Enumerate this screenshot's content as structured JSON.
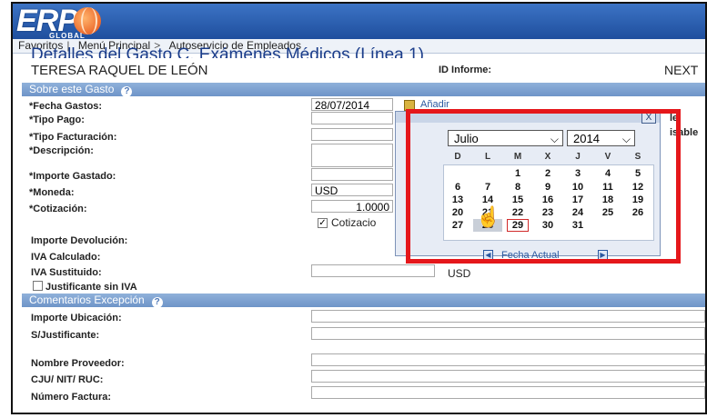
{
  "app": {
    "logo_text": "ERP",
    "logo_subtext": "GLOBAL"
  },
  "nav": {
    "items": [
      "Favoritos",
      "Menú Principal",
      "Autoservicio de Empleados"
    ],
    "separators": [
      "|",
      ">"
    ]
  },
  "page": {
    "title": "Detalles del Gasto C. Exámenes Médicos (Línea 1)",
    "employee": "TERESA RAQUEL DE LEÓN",
    "id_label": "ID Informe:",
    "next": "NEXT"
  },
  "sections": {
    "about": "Sobre este Gasto",
    "comments": "Comentarios Excepción",
    "help_icon": "?"
  },
  "form": {
    "fecha_label": "*Fecha Gastos:",
    "fecha_value": "28/07/2014",
    "add_link": "Añadir",
    "tipo_pago_label": "*Tipo Pago:",
    "tipo_fact_label": "*Tipo Facturación:",
    "descripcion_label": "*Descripción:",
    "importe_label": "*Importe Gastado:",
    "moneda_label": "*Moneda:",
    "moneda_value": "USD",
    "cotizacion_label": "*Cotización:",
    "cotizacion_value": "1.0000",
    "cotizacion_check": "Cotizacio",
    "devolucion_label": "Importe Devolución:",
    "iva_calc_label": "IVA Calculado:",
    "iva_sust_label": "IVA Sustituido:",
    "iva_sust_currency": "USD",
    "justificante_label": "Justificante sin IVA",
    "right_partial_1": "le",
    "right_partial_2": "isable",
    "ubicacion_label": "Importe Ubicación:",
    "sjustificante_label": "S/Justificante:",
    "proveedor_label": "Nombre Proveedor:",
    "cju_label": "CJU/ NIT/ RUC:",
    "factura_label": "Número Factura:"
  },
  "calendar": {
    "close": "X",
    "month": "Julio",
    "year": "2014",
    "weekdays": [
      "D",
      "L",
      "M",
      "X",
      "J",
      "V",
      "S"
    ],
    "days": [
      "1",
      "2",
      "3",
      "4",
      "5",
      "6",
      "7",
      "8",
      "9",
      "10",
      "11",
      "12",
      "13",
      "14",
      "15",
      "16",
      "17",
      "18",
      "19",
      "20",
      "21",
      "22",
      "23",
      "24",
      "25",
      "26",
      "27",
      "28",
      "29",
      "30",
      "31"
    ],
    "today": "29",
    "footer": "Fecha Actual",
    "prev": "◀",
    "next": "▶"
  },
  "colors": {
    "highlight_box": "#e5171b",
    "header": "#2b5fb0",
    "section": "#7fa3d3"
  }
}
